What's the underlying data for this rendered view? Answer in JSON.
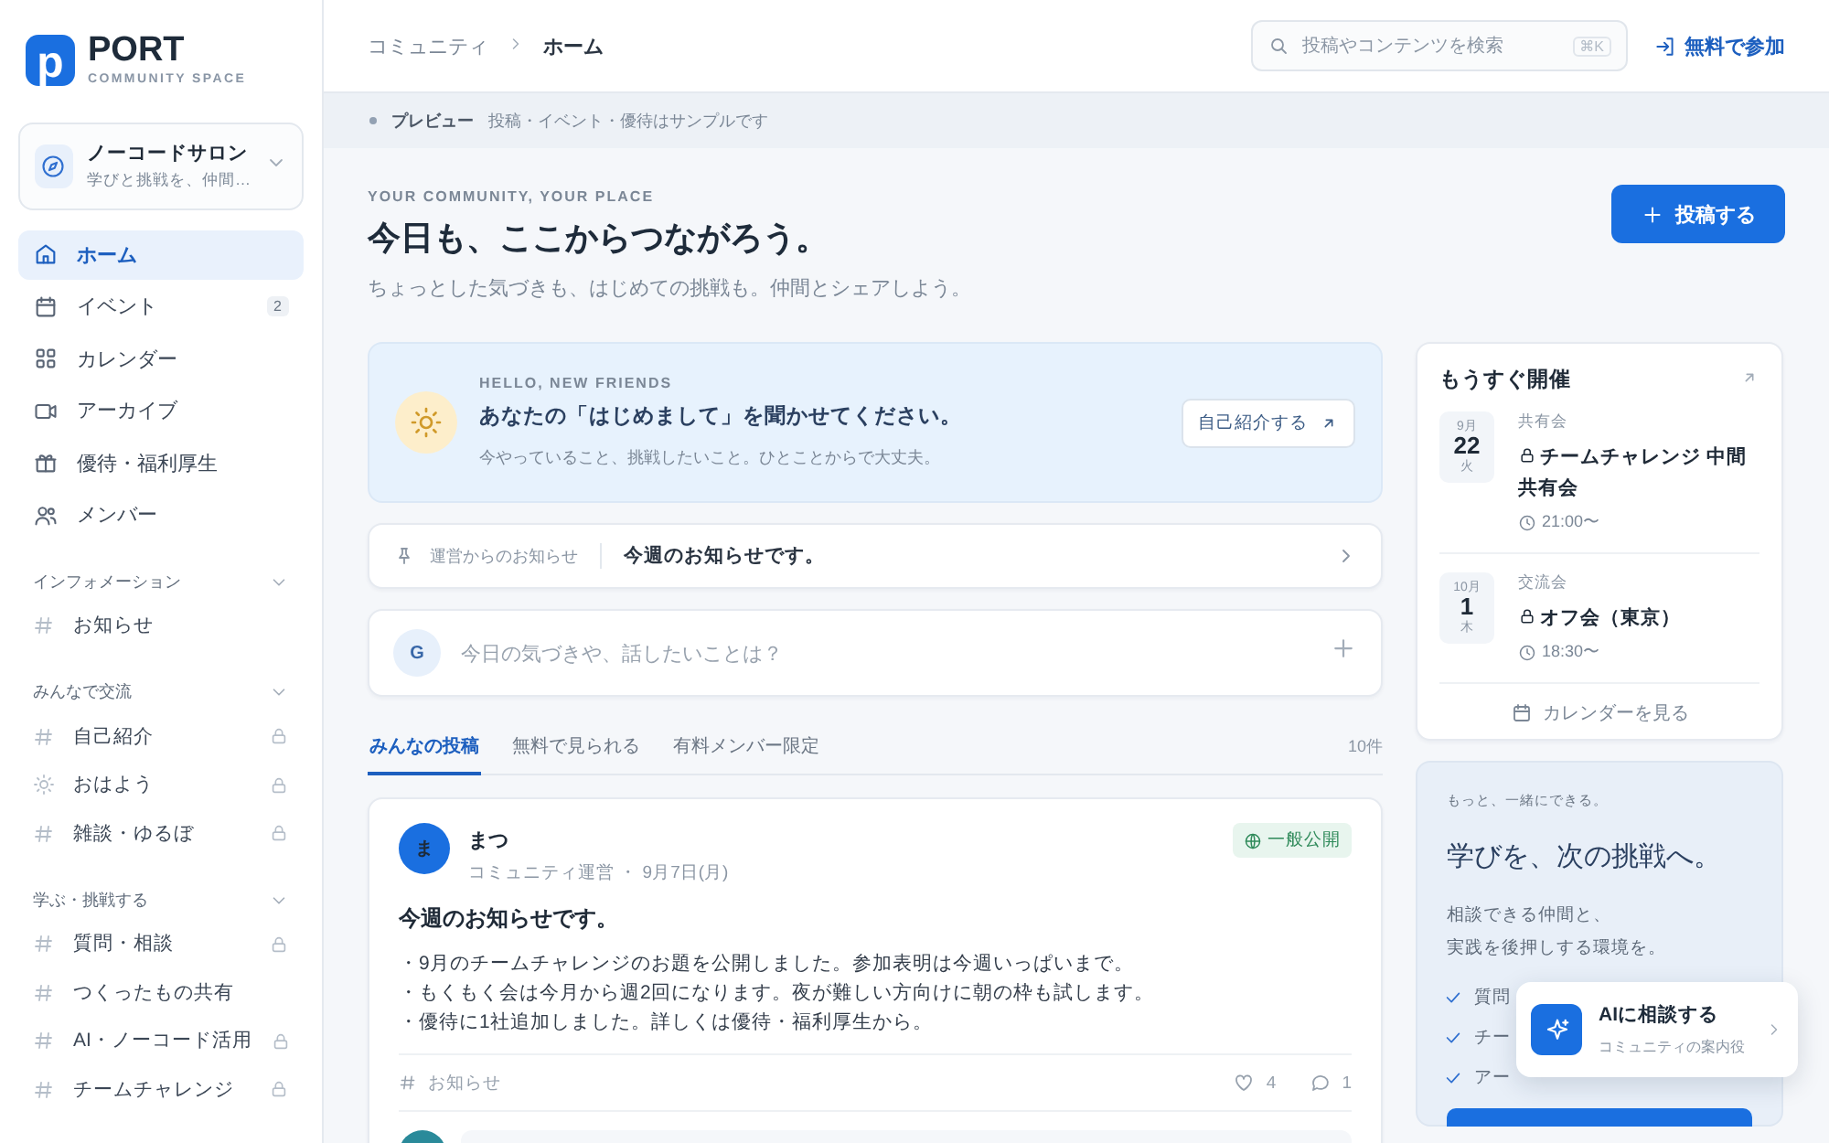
{
  "sidebar": {
    "logo": {
      "mark": "p",
      "name": "PORT",
      "tagline": "COMMUNITY SPACE"
    },
    "community": {
      "name": "ノーコードサロン",
      "description": "学びと挑戦を、仲間…"
    },
    "nav": [
      {
        "kind": "home",
        "label": "ホーム",
        "selected": true
      },
      {
        "kind": "calendar",
        "label": "イベント",
        "selected": false,
        "badge": "2"
      },
      {
        "kind": "grid",
        "label": "カレンダー",
        "selected": false
      },
      {
        "kind": "video",
        "label": "アーカイブ",
        "selected": false
      },
      {
        "kind": "gift",
        "label": "優待・福利厚生",
        "selected": false
      },
      {
        "kind": "users",
        "label": "メンバー",
        "selected": false
      }
    ],
    "groups": [
      {
        "title": "インフォメーション",
        "expanded": true,
        "channels": [
          {
            "kind": "hash",
            "label": "お知らせ",
            "locked": false
          }
        ]
      },
      {
        "title": "みんなで交流",
        "expanded": true,
        "channels": [
          {
            "kind": "hash",
            "label": "自己紹介",
            "locked": true
          },
          {
            "kind": "sun",
            "label": "おはよう",
            "locked": true
          },
          {
            "kind": "hash",
            "label": "雑談・ゆるぼ",
            "locked": true
          }
        ]
      },
      {
        "title": "学ぶ・挑戦する",
        "expanded": true,
        "channels": [
          {
            "kind": "hash",
            "label": "質問・相談",
            "locked": true
          },
          {
            "kind": "hash",
            "label": "つくったもの共有",
            "locked": false
          },
          {
            "kind": "hash",
            "label": "AI・ノーコード活用",
            "locked": true
          },
          {
            "kind": "hash",
            "label": "チームチャレンジ",
            "locked": true
          }
        ]
      }
    ]
  },
  "header": {
    "breadcrumbs": [
      "コミュニティ",
      "ホーム"
    ],
    "search": {
      "placeholder": "投稿やコンテンツを検索",
      "shortcut": "⌘K"
    },
    "join": "無料で参加"
  },
  "preview_bar": {
    "label": "プレビュー",
    "text": "投稿・イベント・優待はサンプルです"
  },
  "hero": {
    "eyebrow": "YOUR COMMUNITY, YOUR PLACE",
    "title": "今日も、ここからつながろう。",
    "subtitle": "ちょっとした気づきも、はじめての挑戦も。仲間とシェアしよう。",
    "post_button": "投稿する"
  },
  "welcome": {
    "eyebrow": "HELLO, NEW FRIENDS",
    "title": "あなたの「はじめまして」を聞かせてください。",
    "text": "今やっていること、挑戦したいこと。ひとことからで大丈夫。",
    "button": "自己紹介する"
  },
  "notice": {
    "label": "運営からのお知らせ",
    "text": "今週のお知らせです。"
  },
  "composer": {
    "avatar": "G",
    "placeholder": "今日の気づきや、話したいことは？"
  },
  "feed_tabs": [
    {
      "label": "みんなの投稿",
      "selected": true
    },
    {
      "label": "無料で見られる",
      "selected": false
    },
    {
      "label": "有料メンバー限定",
      "selected": false
    }
  ],
  "feed_count": "10件",
  "post": {
    "avatar": "ま",
    "author": "まつ",
    "role": "コミュニティ運営",
    "separator": "・",
    "date": "9月7日(月)",
    "visibility": "一般公開",
    "title": "今週のお知らせです。",
    "lines": [
      "・9月のチームチャレンジのお題を公開しました。参加表明は今週いっぱいまで。",
      "・もくもく会は今月から週2回になります。夜が難しい方向けに朝の枠も試します。",
      "・優待に1社追加しました。詳しくは優待・福利厚生から。"
    ],
    "channel": "お知らせ",
    "likes": "4",
    "comments": "1"
  },
  "upcoming": {
    "title": "もうすぐ開催",
    "events": [
      {
        "month": "9月",
        "day": "22",
        "weekday": "火",
        "category": "共有会",
        "title": "チームチャレンジ 中間共有会",
        "time": "21:00〜",
        "locked": true
      },
      {
        "month": "10月",
        "day": "1",
        "weekday": "木",
        "category": "交流会",
        "title": "オフ会（東京）",
        "time": "18:30〜",
        "locked": true
      }
    ],
    "calendar_link": "カレンダーを見る"
  },
  "promo": {
    "eyebrow": "もっと、一緒にできる。",
    "title": "学びを、次の挑戦へ。",
    "text": [
      "相談できる仲間と、",
      "実践を後押しする環境を。"
    ],
    "features": [
      "質問",
      "チー",
      "アー"
    ]
  },
  "ai_button": {
    "title": "AIに相談する",
    "subtitle": "コミュニティの案内役"
  }
}
